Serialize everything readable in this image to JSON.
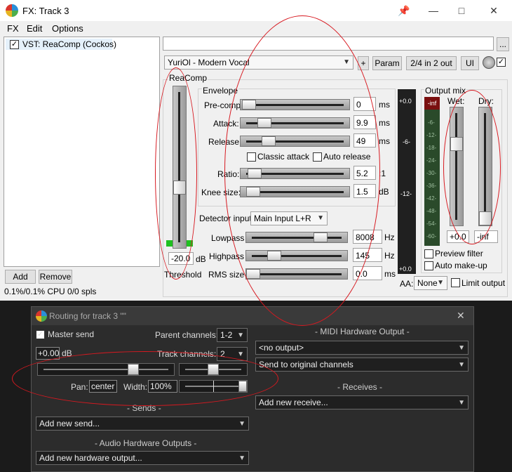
{
  "fx_window": {
    "title": "FX: Track 3",
    "menu": [
      "FX",
      "Edit",
      "Options"
    ],
    "fx_list": [
      {
        "label": "VST: ReaComp (Cockos)",
        "checked": true
      }
    ],
    "buttons": {
      "add": "Add",
      "remove": "Remove",
      "browse": "...",
      "plus": "+",
      "param": "Param",
      "io": "2/4 in 2 out",
      "ui": "UI"
    },
    "cpu": "0.1%/0.1% CPU 0/0 spls",
    "preset": "YuriOl - Modern Vocal"
  },
  "reacomp": {
    "group_label": "ReaComp",
    "envelope_label": "Envelope",
    "threshold_value": "-20.0",
    "threshold_unit": "dB",
    "threshold_label": "Threshold",
    "params": [
      {
        "label": "Pre-comp:",
        "value": "0",
        "unit": "ms"
      },
      {
        "label": "Attack:",
        "value": "9.9",
        "unit": "ms"
      },
      {
        "label": "Release:",
        "value": "49",
        "unit": "ms"
      }
    ],
    "classic_attack": "Classic attack",
    "auto_release": "Auto release",
    "ratio": {
      "label": "Ratio:",
      "value": "5.2",
      "unit": ":1"
    },
    "knee": {
      "label": "Knee size:",
      "value": "1.5",
      "unit": "dB"
    },
    "detector_label": "Detector input:",
    "detector_value": "Main Input L+R",
    "lowpass": {
      "label": "Lowpass",
      "value": "8008",
      "unit": "Hz"
    },
    "highpass": {
      "label": "Highpass",
      "value": "145",
      "unit": "Hz"
    },
    "rms": {
      "label": "RMS size",
      "value": "0.0",
      "unit": "ms"
    },
    "meter_labels": [
      "+0.0",
      "-6-",
      "-12-",
      "+0.0"
    ],
    "output_mix_label": "Output mix",
    "wet_label": "Wet:",
    "dry_label": "Dry:",
    "wet_value": "+0.0",
    "dry_value": "-inf",
    "gr_meter_top": "-inf",
    "gr_scale": [
      "-6-",
      "-12-",
      "-18-",
      "-24-",
      "-30-",
      "-36-",
      "-42-",
      "-48-",
      "-54-",
      "-60-"
    ],
    "preview_filter": "Preview filter",
    "auto_makeup": "Auto make-up",
    "aa_label": "AA:",
    "aa_value": "None",
    "limit_output": "Limit output"
  },
  "routing": {
    "title": "Routing for track 3 \"\"",
    "master_send": "Master send",
    "parent_label": "Parent channels:",
    "parent_value": "1-2",
    "track_channels_label": "Track channels:",
    "track_channels_value": "2",
    "volume_value": "+0.00",
    "volume_unit": "dB",
    "pan_label": "Pan:",
    "pan_value": "center",
    "width_label": "Width:",
    "width_value": "100%",
    "sends_header": "- Sends -",
    "add_send": "Add new send...",
    "audio_hw_header": "- Audio Hardware Outputs -",
    "add_hw_output": "Add new hardware output...",
    "midi_header": "- MIDI Hardware Output -",
    "midi_output": "<no output>",
    "midi_channels": "Send to original channels",
    "receives_header": "- Receives -",
    "add_receive": "Add new receive..."
  },
  "colors": {
    "annotation": "#d71920",
    "meter_red": "#7a0f0f",
    "clip_green": "#20c020"
  }
}
